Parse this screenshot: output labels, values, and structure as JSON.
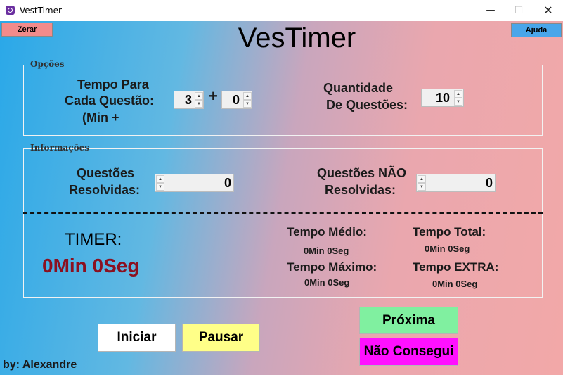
{
  "window": {
    "title": "VestTimer",
    "minimize": "—",
    "maximize": "☐",
    "close": "✕"
  },
  "toolbar": {
    "zerar_label": "Zerar",
    "ajuda_label": "Ajuda"
  },
  "app_title": "VesTimer",
  "opcoes": {
    "group_label": "Opções",
    "tempo_label_line1": "Tempo Para",
    "tempo_label_line2": "Cada Questão:",
    "tempo_label_line3": "(Min +",
    "plus": "+",
    "tempo_minutes": "3",
    "tempo_seconds": "0",
    "quantidade_label_line1": "Quantidade",
    "quantidade_label_line2": "De Questões:",
    "quantidade_value": "10"
  },
  "informacoes": {
    "group_label": "Informações",
    "resolvidas_label_line1": "Questões",
    "resolvidas_label_line2": "Resolvidas:",
    "resolvidas_value": "0",
    "nao_resolvidas_label_line1": "Questões NÃO",
    "nao_resolvidas_label_line2": "Resolvidas:",
    "nao_resolvidas_value": "0"
  },
  "timer": {
    "label": "TIMER:",
    "value": "0Min 0Seg"
  },
  "stats": {
    "tempo_medio_label": "Tempo Médio:",
    "tempo_medio_value": "0Min 0Seg",
    "tempo_total_label": "Tempo Total:",
    "tempo_total_value": "0Min 0Seg",
    "tempo_maximo_label": "Tempo Máximo:",
    "tempo_maximo_value": "0Min 0Seg",
    "tempo_extra_label": "Tempo EXTRA:",
    "tempo_extra_value": "0Min 0Seg"
  },
  "actions": {
    "iniciar_label": "Iniciar",
    "pausar_label": "Pausar",
    "proxima_label": "Próxima",
    "nao_consegui_label": "Não Consegui"
  },
  "author": "by: Alexandre",
  "icons": {
    "spin_up": "▲",
    "spin_down": "▼"
  },
  "colors": {
    "timer_value": "#8b1020",
    "zerar_bg": "#f28b8b",
    "ajuda_bg": "#49a6ea",
    "pausar_bg": "#ffff88",
    "proxima_bg": "#80f0a0",
    "nao_consegui_bg": "#ff10ff"
  }
}
